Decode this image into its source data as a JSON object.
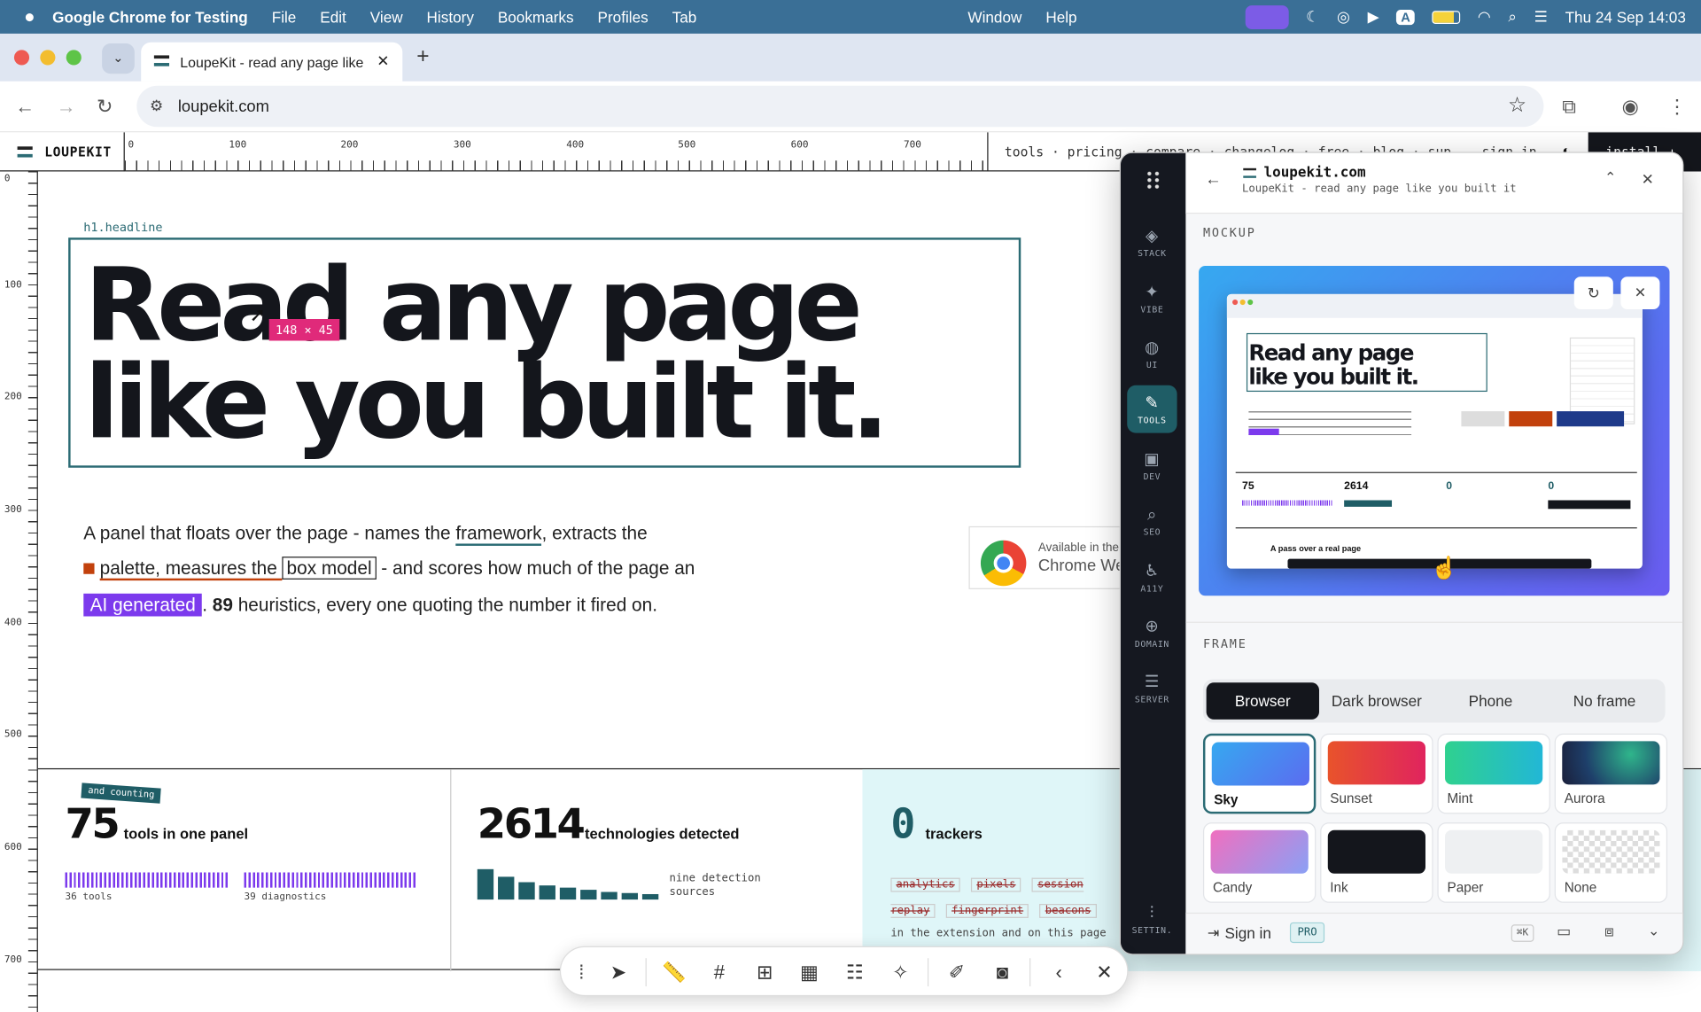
{
  "menubar": {
    "app_name": "Google Chrome for Testing",
    "menus": [
      "File",
      "Edit",
      "View",
      "History",
      "Bookmarks",
      "Profiles",
      "Tab",
      "Window",
      "Help"
    ],
    "datetime": "Thu 24 Sep  14:03"
  },
  "browser": {
    "tab_title": "LoupeKit - read any page like",
    "url": "loupekit.com"
  },
  "site": {
    "logo": "LOUPEKIT",
    "nav": "tools · pricing · compare · changelog · free · blog · support",
    "sign_in": "sign in",
    "install": "install ↓",
    "ruler_top": [
      "0",
      "100",
      "200",
      "300",
      "400",
      "500",
      "600",
      "700"
    ],
    "ruler_left": [
      "0",
      "100",
      "200",
      "300",
      "400",
      "500",
      "600",
      "700"
    ],
    "element_tag": "h1.headline",
    "headline_line1": "Read any page",
    "headline_line2": "like you built it.",
    "measure": "148 × 45",
    "lead": {
      "p1": "A panel that floats over the page - names the ",
      "framework": "framework",
      "p2": ", extracts the",
      "p3": "palette, measures the ",
      "box_model": "box model",
      "p4": " - and scores how much of the page an",
      "ai": "AI generated",
      "p5": ". ",
      "num": "89",
      "p6": " heuristics, every one quoting the number it fired on."
    },
    "chrome_store": {
      "line1": "Available in the",
      "line2": "Chrome Web Store"
    },
    "stats": [
      {
        "badge": "and counting",
        "value": "75",
        "label": "tools in one panel",
        "sub1": "36 tools",
        "sub2": "39 diagnostics"
      },
      {
        "value": "2614",
        "label": "technologies detected",
        "sub": "nine detection sources"
      },
      {
        "value": "0",
        "label": "trackers",
        "struck": [
          "analytics",
          "pixels",
          "session replay",
          "fingerprint",
          "beacons"
        ],
        "note": "in the extension and on this page"
      }
    ]
  },
  "panel": {
    "domain": "loupekit.com",
    "subtitle": "LoupeKit - read any page like you built it",
    "rail": [
      "STACK",
      "VIBE",
      "UI",
      "TOOLS",
      "DEV",
      "SEO",
      "A11Y",
      "DOMAIN",
      "SERVER",
      "SETTIN."
    ],
    "mockup_label": "MOCKUP",
    "mockup_headline1": "Read any page",
    "mockup_headline2": "like you built it.",
    "mockup_pass": "A pass over a real page",
    "frame_label": "FRAME",
    "frame_options": [
      "Browser",
      "Dark browser",
      "Phone",
      "No frame"
    ],
    "frame_selected": "Browser",
    "backgrounds": [
      "Sky",
      "Sunset",
      "Mint",
      "Aurora",
      "Candy",
      "Ink",
      "Paper",
      "None"
    ],
    "bg_selected": "Sky",
    "sign_in": "Sign in",
    "pro": "PRO",
    "shortcut": "⌘K"
  },
  "colors": {
    "accent": "#2b6b74",
    "measure": "#e02a7a",
    "ai": "#7c3aed",
    "rail": "#151820"
  }
}
